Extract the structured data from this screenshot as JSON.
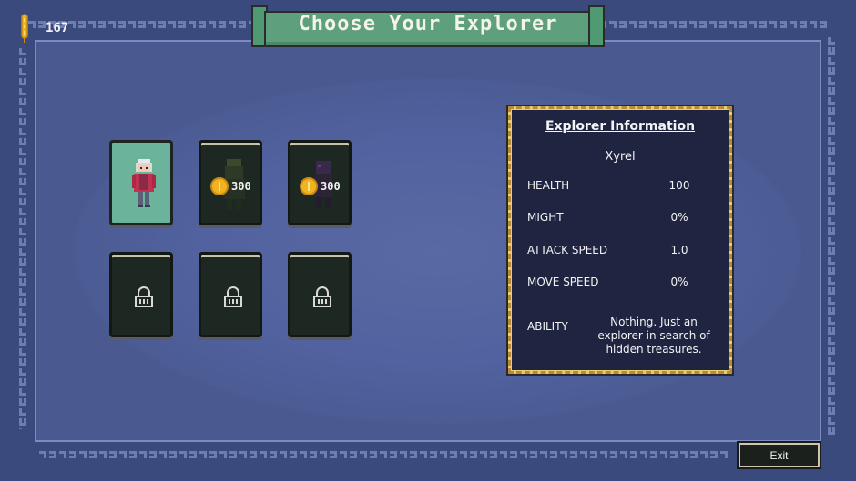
{
  "header": {
    "title": "Choose Your Explorer",
    "gold": "167",
    "gold_icon": "wheat-icon"
  },
  "explorers": [
    {
      "id": "xyrel",
      "state": "unlocked",
      "selected": true
    },
    {
      "id": "explorer-2",
      "state": "for-sale",
      "price": "300"
    },
    {
      "id": "explorer-3",
      "state": "for-sale",
      "price": "300"
    },
    {
      "id": "explorer-4",
      "state": "locked"
    },
    {
      "id": "explorer-5",
      "state": "locked"
    },
    {
      "id": "explorer-6",
      "state": "locked"
    }
  ],
  "info": {
    "title": "Explorer Information",
    "name": "Xyrel",
    "stats": [
      {
        "label": "HEALTH",
        "value": "100"
      },
      {
        "label": "MIGHT",
        "value": "0%"
      },
      {
        "label": "ATTACK SPEED",
        "value": "1.0"
      },
      {
        "label": "MOVE SPEED",
        "value": "0%"
      }
    ],
    "ability_label": "ABILITY",
    "ability_desc": "Nothing. Just an explorer in search of hidden treasures."
  },
  "footer": {
    "exit_label": "Exit"
  },
  "colors": {
    "background": "#3a4a7c",
    "inner_panel": "#4a5a91",
    "banner": "#5ea07d",
    "card_unlocked": "#6bb39a",
    "card_dark": "#1e2822",
    "info_bg": "#1f2441",
    "info_border": "#e9cf6e",
    "coin": "#f0b321"
  }
}
